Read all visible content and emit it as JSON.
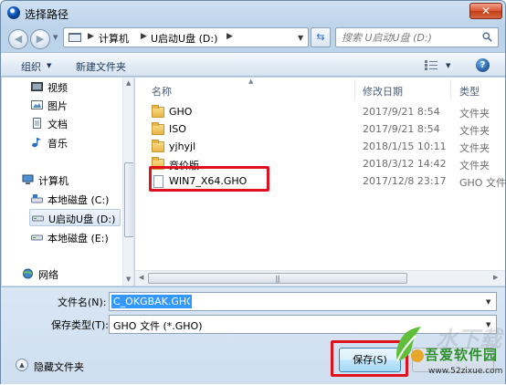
{
  "window": {
    "title": "选择路径",
    "close_glyph": "✕"
  },
  "address": {
    "crumbs": [
      "计算机",
      "U启动U盘 (D:)"
    ],
    "search_placeholder": "搜索 U启动U盘 (D:)"
  },
  "toolbar": {
    "organize": "组织",
    "new_folder": "新建文件夹",
    "help": "?"
  },
  "nav": {
    "items": [
      {
        "label": "视频",
        "icon": "video-icon"
      },
      {
        "label": "图片",
        "icon": "picture-icon"
      },
      {
        "label": "文档",
        "icon": "document-icon"
      },
      {
        "label": "音乐",
        "icon": "music-icon"
      },
      {
        "label": "计算机",
        "icon": "computer-icon"
      },
      {
        "label": "本地磁盘 (C:)",
        "icon": "drive-icon"
      },
      {
        "label": "U启动U盘 (D:)",
        "icon": "usb-drive-icon"
      },
      {
        "label": "本地磁盘 (E:)",
        "icon": "drive-icon"
      },
      {
        "label": "网络",
        "icon": "network-icon"
      }
    ]
  },
  "columns": {
    "name": "名称",
    "date": "修改日期",
    "type": "类型"
  },
  "files": [
    {
      "name": "GHO",
      "date": "2017/9/21 8:54",
      "type": "文件夹",
      "kind": "folder"
    },
    {
      "name": "ISO",
      "date": "2017/9/21 8:54",
      "type": "文件夹",
      "kind": "folder"
    },
    {
      "name": "yjhyjl",
      "date": "2018/1/15 10:11",
      "type": "文件夹",
      "kind": "folder"
    },
    {
      "name": "竞价版",
      "date": "2018/3/12 14:42",
      "type": "文件夹",
      "kind": "folder"
    },
    {
      "name": "WIN7_X64.GHO",
      "date": "2017/12/8 23:17",
      "type": "GHO 文件",
      "kind": "file"
    }
  ],
  "form": {
    "filename_label": "文件名(N):",
    "filename_value": "C_OKGBAK.GHO",
    "type_label": "保存类型(T):",
    "type_value": "GHO 文件 (*.GHO)",
    "hide_folders": "隐藏文件夹",
    "save": "保存(S)"
  },
  "watermark": {
    "faint": "水下载",
    "main": "吾爱软件园",
    "url": "www.52zixue.com"
  },
  "colors": {
    "highlight": "#e0101c",
    "accent": "#3399ff"
  }
}
